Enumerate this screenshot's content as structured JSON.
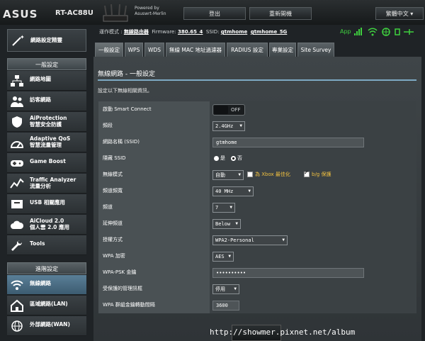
{
  "header": {
    "brand": "ASUS",
    "model": "RT-AC88U",
    "powered_by_line1": "Powered by",
    "powered_by_line2": "Asuswrt-Merlin",
    "logout": "登出",
    "reboot": "重新開機",
    "language": "繁體中文"
  },
  "status": {
    "opmode_label": "運作模式 :",
    "opmode_value": "無線路由器",
    "firmware_label": "Firmware:",
    "firmware_value": "380.65_4",
    "ssid_label": "SSID:",
    "ssid_1": "gtmhome",
    "ssid_2": "gtmhome_5G",
    "app_label": "App"
  },
  "sidebar": {
    "quick_setup": "網路設定精靈",
    "general_header": "一般設定",
    "general_items": [
      {
        "label": "網路地圖",
        "icon": "network-map-icon"
      },
      {
        "label": "訪客網路",
        "icon": "guest-network-icon"
      },
      {
        "label": "AiProtection",
        "label2": "智慧安全防護",
        "icon": "aiprotection-icon"
      },
      {
        "label": "Adaptive QoS",
        "label2": "智慧流量管理",
        "icon": "qos-icon"
      },
      {
        "label": "Game Boost",
        "icon": "game-icon"
      },
      {
        "label": "Traffic Analyzer",
        "label2": "流量分析",
        "icon": "traffic-icon"
      },
      {
        "label": "USB 相關應用",
        "icon": "usb-icon"
      },
      {
        "label": "AiCloud 2.0",
        "label2": "個人雲 2.0 應用",
        "icon": "cloud-icon"
      },
      {
        "label": "Tools",
        "icon": "tools-icon"
      }
    ],
    "advanced_header": "進階設定",
    "advanced_items": [
      {
        "label": "無線網路",
        "icon": "wireless-icon"
      },
      {
        "label": "區域網路(LAN)",
        "icon": "lan-icon"
      },
      {
        "label": "外部網路(WAN)",
        "icon": "wan-icon"
      }
    ]
  },
  "tabs": [
    "一般設定",
    "WPS",
    "WDS",
    "無線 MAC 地址過濾器",
    "RADIUS 設定",
    "專業設定",
    "Site Survey"
  ],
  "main": {
    "title": "無線網路 - 一般設定",
    "description": "設定以下無線相關資訊。",
    "rows": {
      "smart_connect": {
        "label": "啟動 Smart Connect",
        "value": "OFF"
      },
      "band": {
        "label": "頻段",
        "value": "2.4GHz"
      },
      "ssid": {
        "label": "網路名稱 (SSID)",
        "value": "gtmhome"
      },
      "hide_ssid": {
        "label": "隱藏 SSID",
        "yes": "是",
        "no": "否"
      },
      "wireless_mode": {
        "label": "無線模式",
        "value": "自動",
        "xbox": "為 Xbox 最佳化",
        "bg": "b/g 保護"
      },
      "bandwidth": {
        "label": "頻道頻寬",
        "value": "40 MHz"
      },
      "channel": {
        "label": "頻道",
        "value": "7"
      },
      "ext_channel": {
        "label": "延伸頻道",
        "value": "Below"
      },
      "auth": {
        "label": "授權方式",
        "value": "WPA2-Personal"
      },
      "wpa_enc": {
        "label": "WPA 加密",
        "value": "AES"
      },
      "wpa_psk": {
        "label": "WPA-PSK 金鑰",
        "value": "••••••••••"
      },
      "pmf": {
        "label": "受保護的管理訊框",
        "value": "停用"
      },
      "group_key": {
        "label": "WPA 群組金鑰轉動間隔",
        "value": "3600"
      }
    }
  },
  "watermark": "http://showmer.pixnet.net/album",
  "colors": {
    "accent": "#7da9c3",
    "status_green": "#3fd13f",
    "highlight": "#f0c040"
  }
}
